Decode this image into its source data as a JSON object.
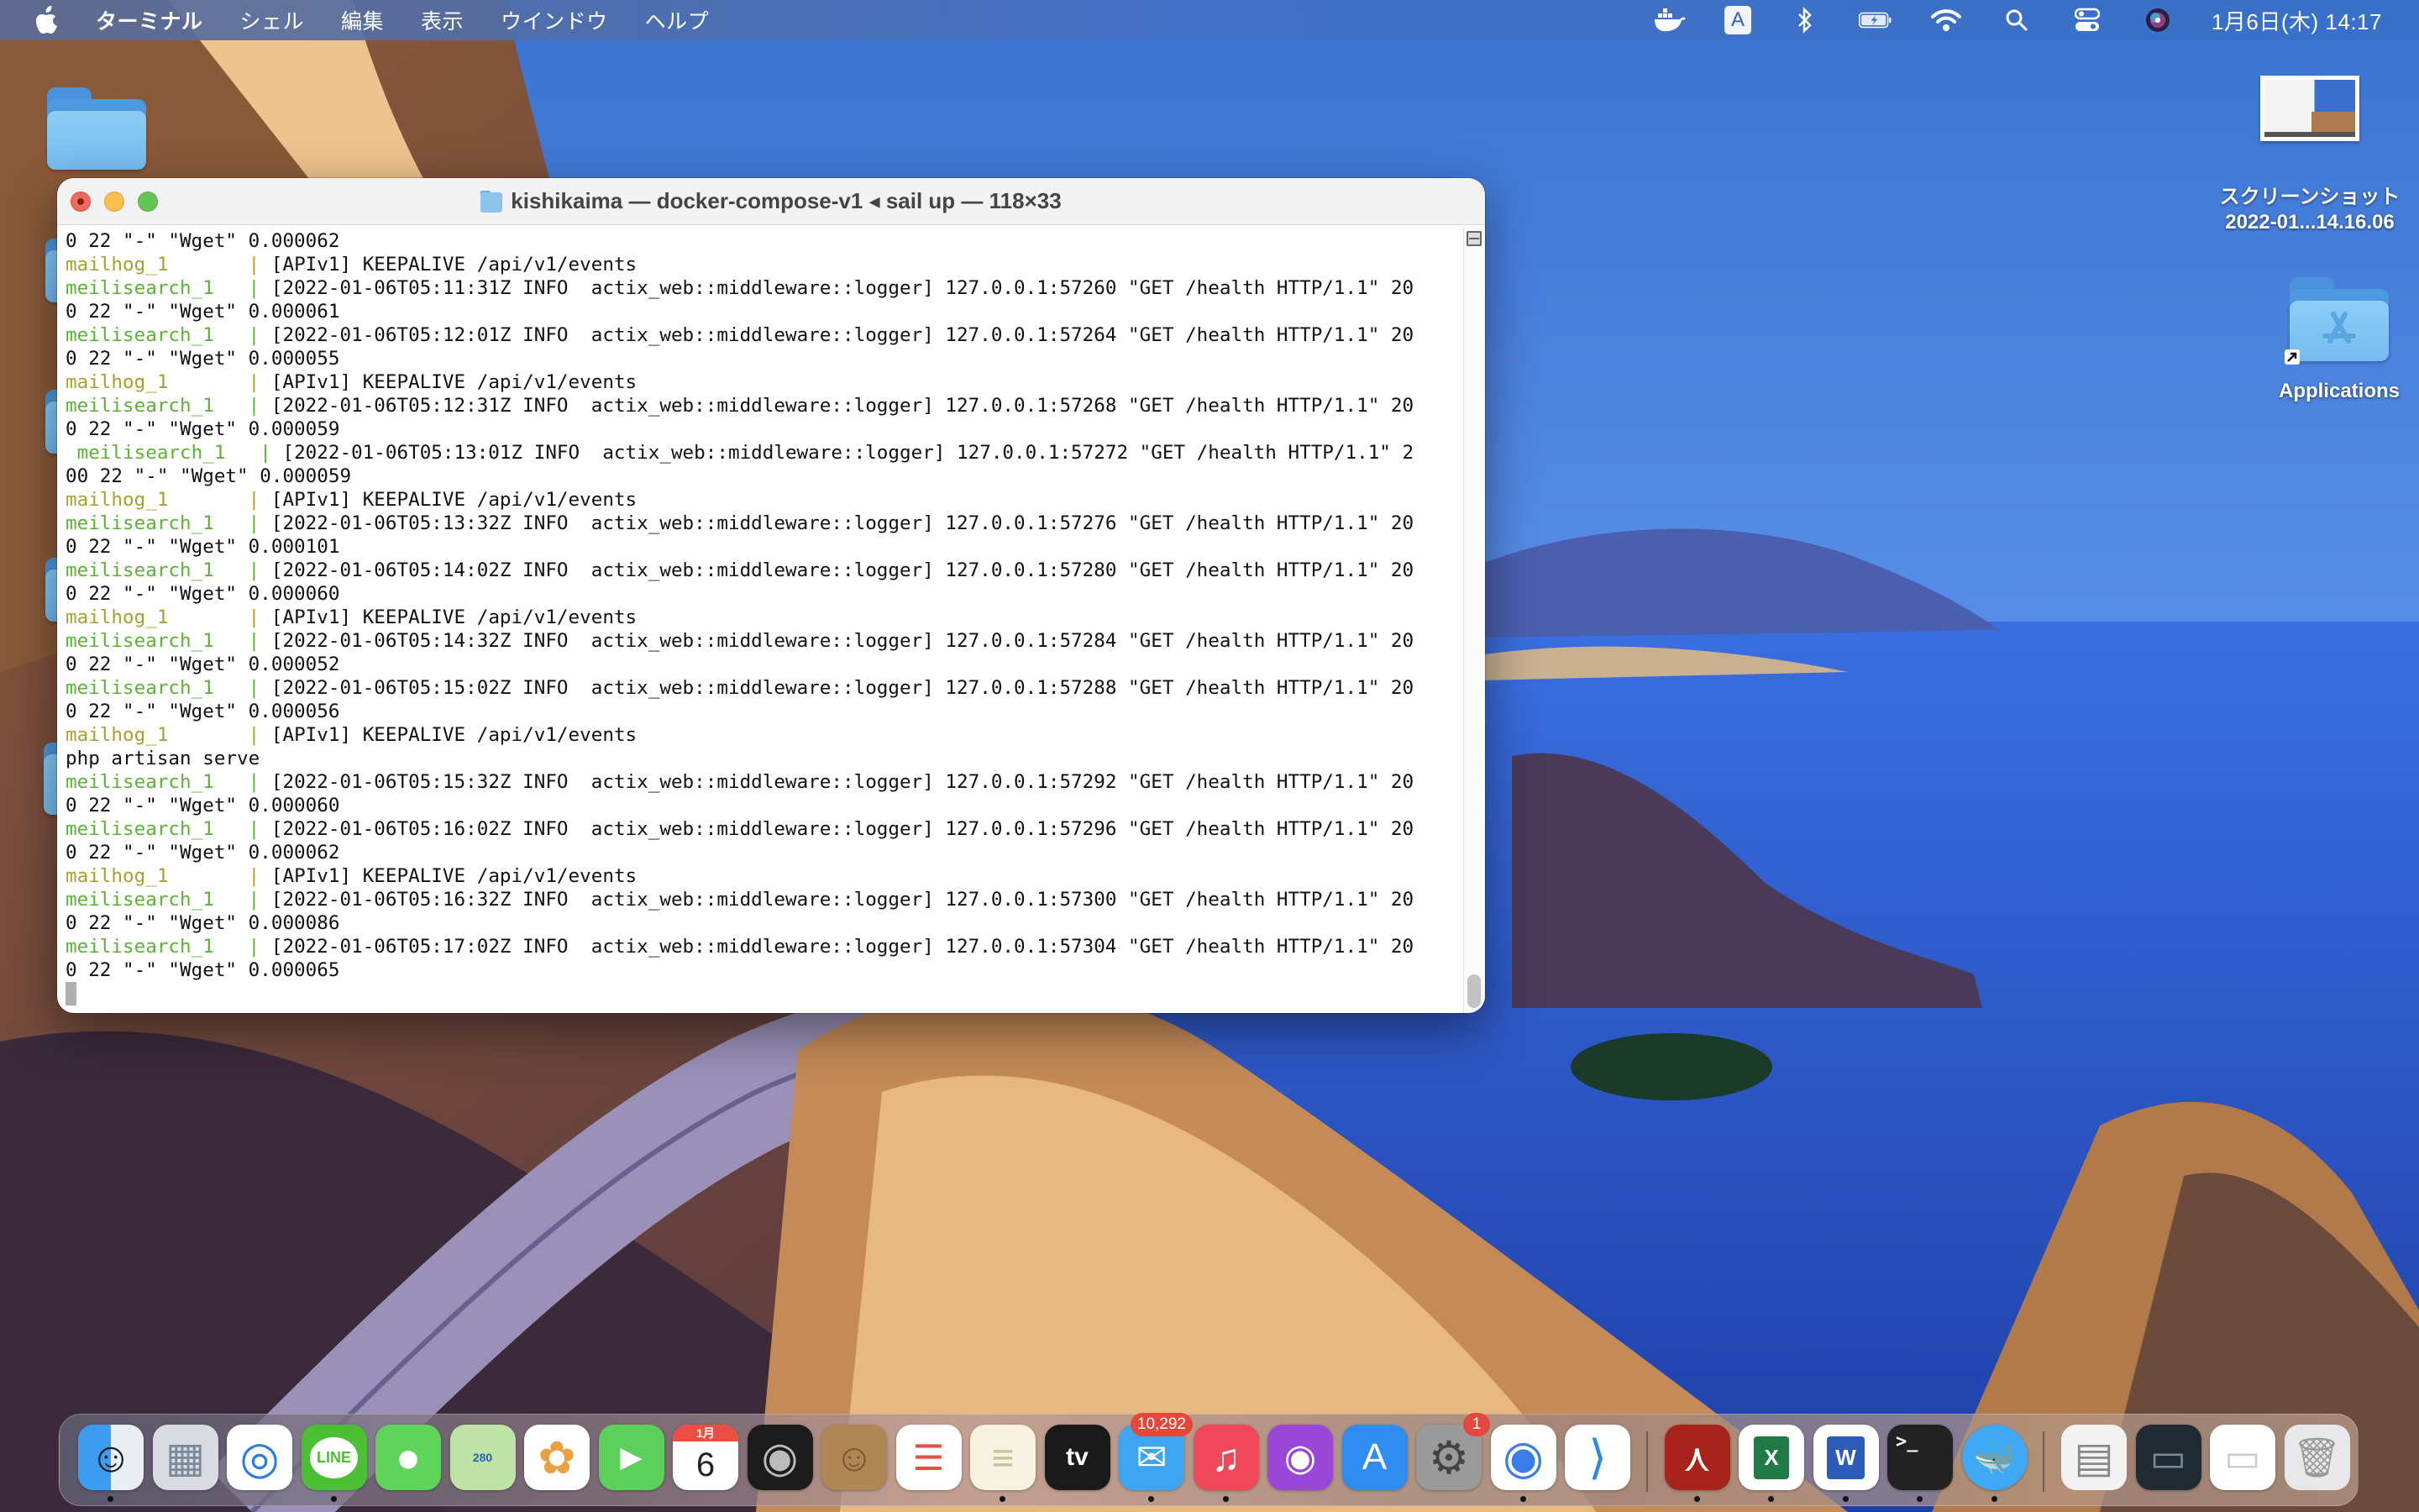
{
  "menubar": {
    "app_name": "ターミナル",
    "menus": [
      "シェル",
      "編集",
      "表示",
      "ウインドウ",
      "ヘルプ"
    ],
    "input_mode": "A",
    "clock": "1月6日(木)  14:17",
    "status_icons": [
      "docker-icon",
      "input-source-icon",
      "bluetooth-icon",
      "battery-charging-icon",
      "wifi-icon",
      "spotlight-search-icon",
      "control-center-icon",
      "siri-icon"
    ]
  },
  "desktop": {
    "screenshot_file": {
      "line1": "スクリーンショット",
      "line2": "2022-01...14.16.06"
    },
    "applications_alias": "Applications"
  },
  "terminal": {
    "title": "kishikaima — docker-compose-v1 ◂ sail up — 118×33",
    "lines": [
      {
        "type": "plain",
        "text": "0 22 \"-\" \"Wget\" 0.000062"
      },
      {
        "type": "mailhog",
        "service": "mailhog_1       ",
        "text": " [APIv1] KEEPALIVE /api/v1/events"
      },
      {
        "type": "meili",
        "service": "meilisearch_1   ",
        "text": " [2022-01-06T05:11:31Z INFO  actix_web::middleware::logger] 127.0.0.1:57260 \"GET /health HTTP/1.1\" 20"
      },
      {
        "type": "plain",
        "text": "0 22 \"-\" \"Wget\" 0.000061"
      },
      {
        "type": "meili",
        "service": "meilisearch_1   ",
        "text": " [2022-01-06T05:12:01Z INFO  actix_web::middleware::logger] 127.0.0.1:57264 \"GET /health HTTP/1.1\" 20"
      },
      {
        "type": "plain",
        "text": "0 22 \"-\" \"Wget\" 0.000055"
      },
      {
        "type": "mailhog",
        "service": "mailhog_1       ",
        "text": " [APIv1] KEEPALIVE /api/v1/events"
      },
      {
        "type": "meili",
        "service": "meilisearch_1   ",
        "text": " [2022-01-06T05:12:31Z INFO  actix_web::middleware::logger] 127.0.0.1:57268 \"GET /health HTTP/1.1\" 20"
      },
      {
        "type": "plain",
        "text": "0 22 \"-\" \"Wget\" 0.000059"
      },
      {
        "type": "meili",
        "service": " meilisearch_1   ",
        "text": " [2022-01-06T05:13:01Z INFO  actix_web::middleware::logger] 127.0.0.1:57272 \"GET /health HTTP/1.1\" 2"
      },
      {
        "type": "plain",
        "text": "00 22 \"-\" \"Wget\" 0.000059"
      },
      {
        "type": "mailhog",
        "service": "mailhog_1       ",
        "text": " [APIv1] KEEPALIVE /api/v1/events"
      },
      {
        "type": "meili",
        "service": "meilisearch_1   ",
        "text": " [2022-01-06T05:13:32Z INFO  actix_web::middleware::logger] 127.0.0.1:57276 \"GET /health HTTP/1.1\" 20"
      },
      {
        "type": "plain",
        "text": "0 22 \"-\" \"Wget\" 0.000101"
      },
      {
        "type": "meili",
        "service": "meilisearch_1   ",
        "text": " [2022-01-06T05:14:02Z INFO  actix_web::middleware::logger] 127.0.0.1:57280 \"GET /health HTTP/1.1\" 20"
      },
      {
        "type": "plain",
        "text": "0 22 \"-\" \"Wget\" 0.000060"
      },
      {
        "type": "mailhog",
        "service": "mailhog_1       ",
        "text": " [APIv1] KEEPALIVE /api/v1/events"
      },
      {
        "type": "meili",
        "service": "meilisearch_1   ",
        "text": " [2022-01-06T05:14:32Z INFO  actix_web::middleware::logger] 127.0.0.1:57284 \"GET /health HTTP/1.1\" 20"
      },
      {
        "type": "plain",
        "text": "0 22 \"-\" \"Wget\" 0.000052"
      },
      {
        "type": "meili",
        "service": "meilisearch_1   ",
        "text": " [2022-01-06T05:15:02Z INFO  actix_web::middleware::logger] 127.0.0.1:57288 \"GET /health HTTP/1.1\" 20"
      },
      {
        "type": "plain",
        "text": "0 22 \"-\" \"Wget\" 0.000056"
      },
      {
        "type": "mailhog",
        "service": "mailhog_1       ",
        "text": " [APIv1] KEEPALIVE /api/v1/events"
      },
      {
        "type": "plain",
        "text": "php artisan serve"
      },
      {
        "type": "meili",
        "service": "meilisearch_1   ",
        "text": " [2022-01-06T05:15:32Z INFO  actix_web::middleware::logger] 127.0.0.1:57292 \"GET /health HTTP/1.1\" 20"
      },
      {
        "type": "plain",
        "text": "0 22 \"-\" \"Wget\" 0.000060"
      },
      {
        "type": "meili",
        "service": "meilisearch_1   ",
        "text": " [2022-01-06T05:16:02Z INFO  actix_web::middleware::logger] 127.0.0.1:57296 \"GET /health HTTP/1.1\" 20"
      },
      {
        "type": "plain",
        "text": "0 22 \"-\" \"Wget\" 0.000062"
      },
      {
        "type": "mailhog",
        "service": "mailhog_1       ",
        "text": " [APIv1] KEEPALIVE /api/v1/events"
      },
      {
        "type": "meili",
        "service": "meilisearch_1   ",
        "text": " [2022-01-06T05:16:32Z INFO  actix_web::middleware::logger] 127.0.0.1:57300 \"GET /health HTTP/1.1\" 20"
      },
      {
        "type": "plain",
        "text": "0 22 \"-\" \"Wget\" 0.000086"
      },
      {
        "type": "meili",
        "service": "meilisearch_1   ",
        "text": " [2022-01-06T05:17:02Z INFO  actix_web::middleware::logger] 127.0.0.1:57304 \"GET /health HTTP/1.1\" 20"
      },
      {
        "type": "plain",
        "text": "0 22 \"-\" \"Wget\" 0.000065"
      }
    ],
    "pipe": "|"
  },
  "colors": {
    "mailhog_service": "#a7a22f",
    "meilisearch_service": "#5bb336",
    "close": "#ee6a5f",
    "minimize": "#f5be4f",
    "zoom": "#62c554"
  },
  "dock": {
    "items": [
      {
        "name": "finder",
        "label": "",
        "bg": "linear-gradient(90deg,#3c9cf1 50%,#e8eef4 50%)",
        "running": true
      },
      {
        "name": "launchpad",
        "label": "",
        "bg": "#d9dbe0",
        "running": false
      },
      {
        "name": "safari",
        "label": "",
        "bg": "#ffffff",
        "running": false
      },
      {
        "name": "line",
        "label": "LINE",
        "bg": "#4cc034",
        "running": true
      },
      {
        "name": "messages",
        "label": "",
        "bg": "#5fd45b",
        "running": false
      },
      {
        "name": "maps",
        "label": "280",
        "bg": "#bfe3a6",
        "running": false
      },
      {
        "name": "photos",
        "label": "",
        "bg": "#ffffff",
        "running": false
      },
      {
        "name": "facetime",
        "label": "",
        "bg": "#5bd05a",
        "running": false
      },
      {
        "name": "calendar",
        "label": "6",
        "sublabel": "1月",
        "bg": "#ffffff",
        "running": false
      },
      {
        "name": "logic-pro",
        "label": "",
        "bg": "#1c1c1c",
        "running": false
      },
      {
        "name": "contacts",
        "label": "",
        "bg": "#b08654",
        "running": false
      },
      {
        "name": "reminders",
        "label": "",
        "bg": "#ffffff",
        "running": false
      },
      {
        "name": "notes",
        "label": "",
        "bg": "#f6f2e0",
        "running": true
      },
      {
        "name": "apple-tv",
        "label": "tv",
        "bg": "#1a1a1a",
        "running": false
      },
      {
        "name": "mail",
        "label": "",
        "bg": "#3da6f3",
        "badge": "10,292",
        "running": true
      },
      {
        "name": "music",
        "label": "",
        "bg": "#f0475b",
        "running": true
      },
      {
        "name": "podcasts",
        "label": "",
        "bg": "#9a46d8",
        "running": false
      },
      {
        "name": "app-store",
        "label": "",
        "bg": "#2f8cf0",
        "running": false
      },
      {
        "name": "system-preferences",
        "label": "",
        "bg": "#9a9a9a",
        "badge": "1",
        "running": false
      },
      {
        "name": "chrome",
        "label": "",
        "bg": "#ffffff",
        "running": true
      },
      {
        "name": "vscode",
        "label": "",
        "bg": "#ffffff",
        "running": false
      },
      {
        "name": "acrobat",
        "label": "",
        "bg": "#a8231a",
        "running": true
      },
      {
        "name": "excel",
        "label": "X",
        "bg": "#ffffff",
        "running": true
      },
      {
        "name": "word",
        "label": "W",
        "bg": "#ffffff",
        "running": true
      },
      {
        "name": "terminal",
        "label": ">_",
        "bg": "#222222",
        "running": true
      },
      {
        "name": "docker",
        "label": "",
        "bg": "#3fa9f5",
        "running": true
      },
      {
        "name": "documents-stack",
        "label": "",
        "bg": "#f2f2f2",
        "running": false
      },
      {
        "name": "docker-dashboard-window",
        "label": "",
        "bg": "#1f2a33",
        "running": false
      },
      {
        "name": "docker-window",
        "label": "",
        "bg": "#ffffff",
        "running": false
      },
      {
        "name": "trash",
        "label": "",
        "bg": "#e8e8ea",
        "running": false
      }
    ]
  }
}
